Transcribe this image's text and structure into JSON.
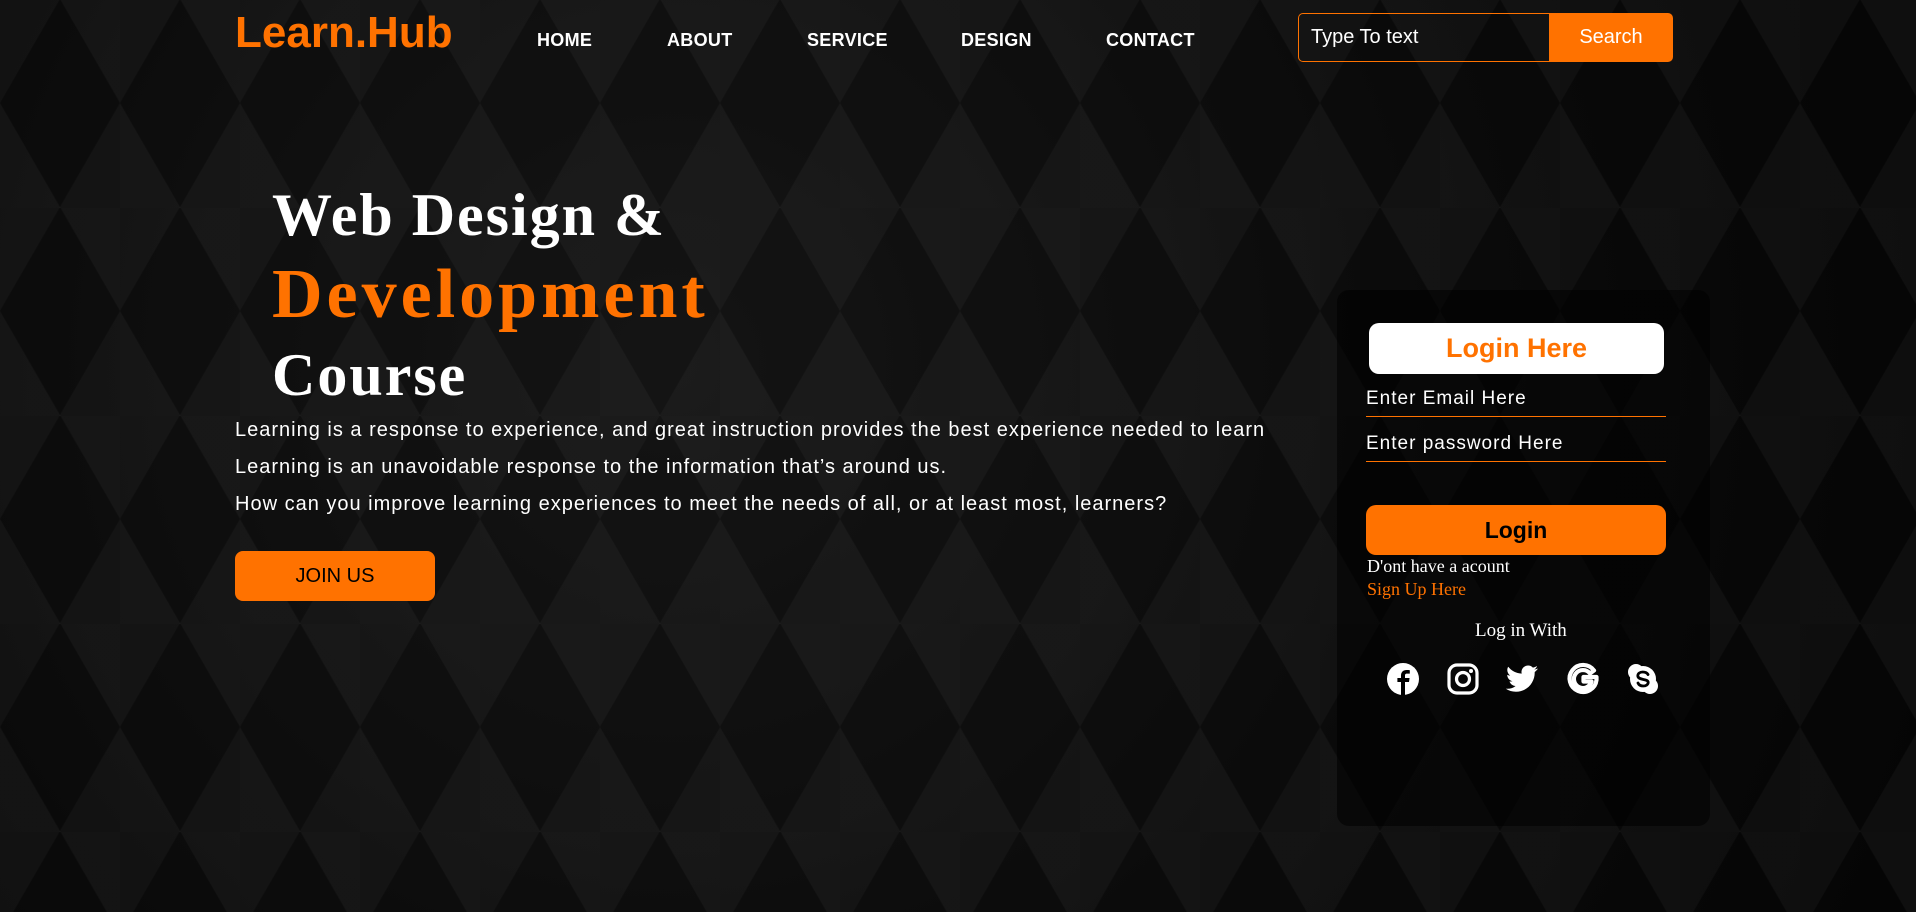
{
  "brand": {
    "name": "Learn.Hub",
    "accent": "#ff7200"
  },
  "nav": {
    "items": [
      "HOME",
      "ABOUT",
      "SERVICE",
      "DESIGN",
      "CONTACT"
    ]
  },
  "search": {
    "placeholder": "Type To text",
    "button": "Search"
  },
  "hero": {
    "line1": "Web Design &",
    "line2": "Development",
    "line3": "Course",
    "paragraphs": [
      "Learning is a response to experience, and great instruction provides the best experience needed to learn",
      "Learning is an unavoidable response to the information that’s around us.",
      "How can you improve learning experiences to meet the needs of all, or at least most, learners?"
    ],
    "cta": "JOIN US"
  },
  "login": {
    "title": "Login Here",
    "email_placeholder": "Enter Email Here",
    "password_placeholder": "Enter password Here",
    "button": "Login",
    "no_account": "D'ont have a acount",
    "signup_link": "Sign Up Here",
    "login_with": "Log in With",
    "social_icons": [
      "facebook-icon",
      "instagram-icon",
      "twitter-icon",
      "google-icon",
      "skype-icon"
    ]
  }
}
